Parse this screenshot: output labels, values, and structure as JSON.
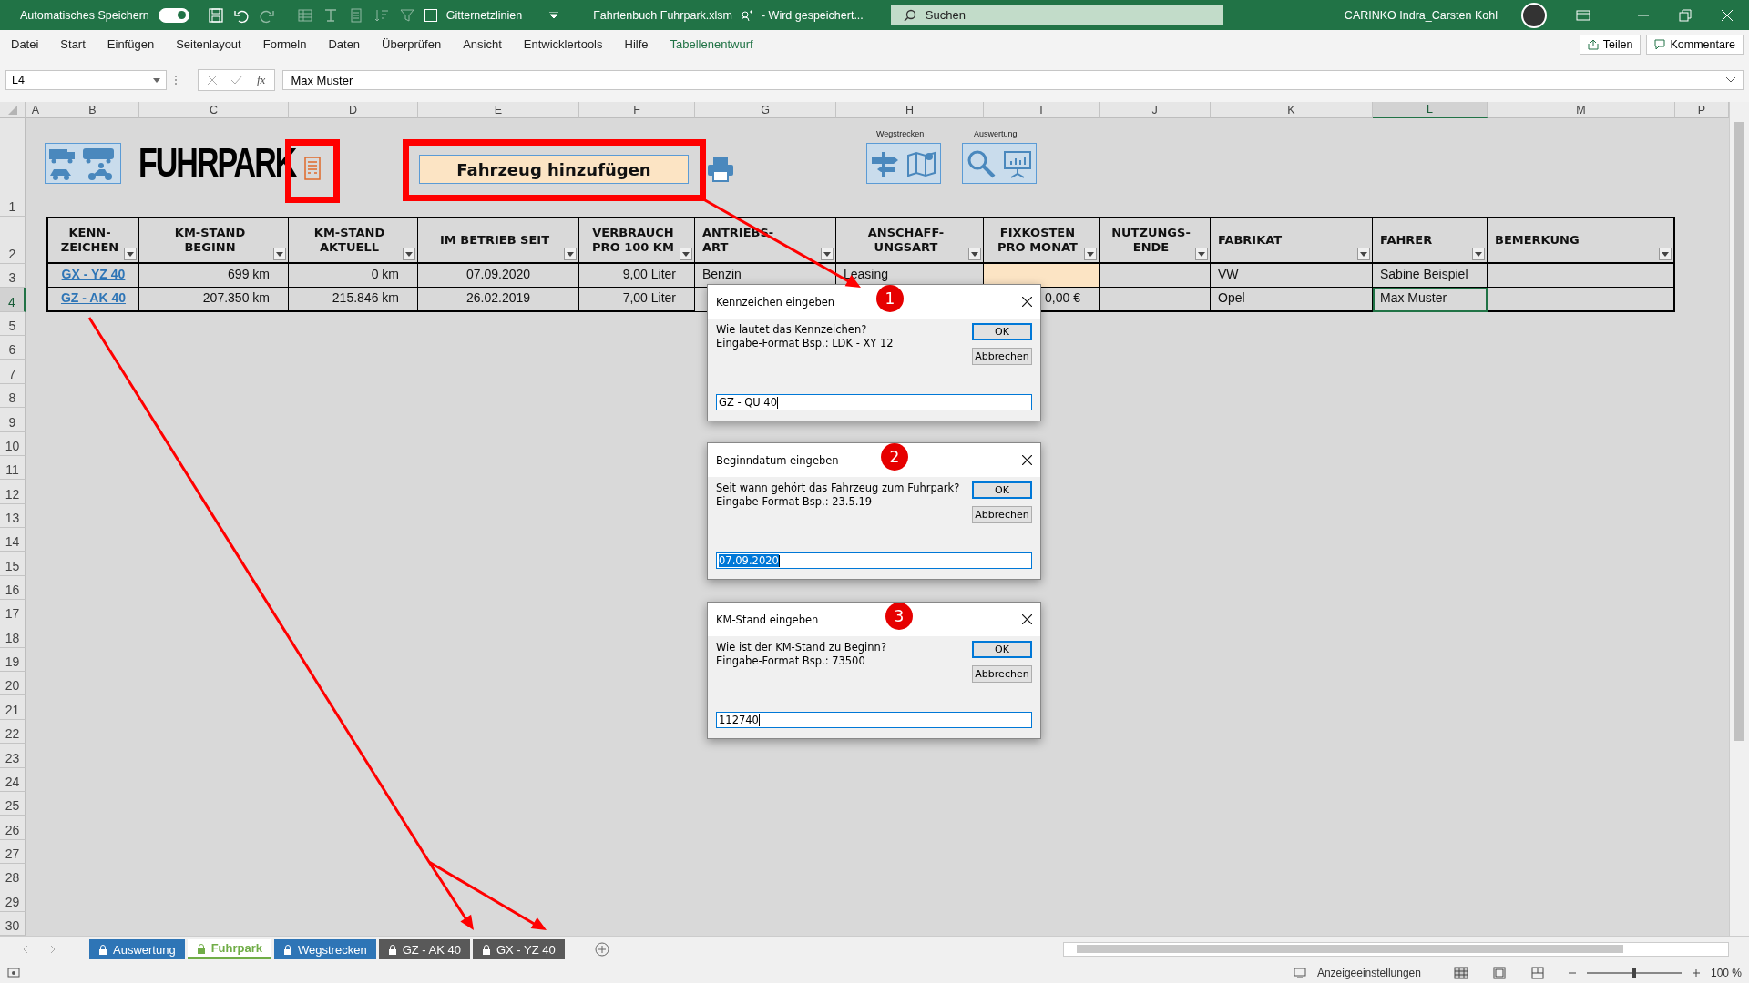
{
  "title_bar": {
    "autosave_label": "Automatisches Speichern",
    "autosave_on": true,
    "gridlines_label": "Gitternetzlinien",
    "gridlines_checked": false,
    "file_name": "Fahrtenbuch Fuhrpark.xlsm",
    "save_status": "- Wird gespeichert...",
    "search_placeholder": "Suchen",
    "user": "CARINKO Indra_Carsten Kohl"
  },
  "menu": [
    {
      "label": "Datei",
      "kind": "tab"
    },
    {
      "label": "Start",
      "kind": "tab"
    },
    {
      "label": "Einfügen",
      "kind": "tab"
    },
    {
      "label": "Seitenlayout",
      "kind": "tab"
    },
    {
      "label": "Formeln",
      "kind": "tab"
    },
    {
      "label": "Daten",
      "kind": "tab"
    },
    {
      "label": "Überprüfen",
      "kind": "tab"
    },
    {
      "label": "Ansicht",
      "kind": "tab"
    },
    {
      "label": "Entwicklertools",
      "kind": "tab"
    },
    {
      "label": "Hilfe",
      "kind": "tab"
    },
    {
      "label": "Tabellenentwurf",
      "kind": "context"
    }
  ],
  "share_button": "Teilen",
  "comments_button": "Kommentare",
  "formula_bar": {
    "name_box": "L4",
    "function_label": "fx",
    "value": "Max Muster"
  },
  "column_headers": [
    {
      "label": "A",
      "selected": false
    },
    {
      "label": "B",
      "selected": false
    },
    {
      "label": "C",
      "selected": false
    },
    {
      "label": "D",
      "selected": false
    },
    {
      "label": "E",
      "selected": false
    },
    {
      "label": "F",
      "selected": false
    },
    {
      "label": "G",
      "selected": false
    },
    {
      "label": "H",
      "selected": false
    },
    {
      "label": "I",
      "selected": false
    },
    {
      "label": "J",
      "selected": false
    },
    {
      "label": "K",
      "selected": false
    },
    {
      "label": "L",
      "selected": true
    },
    {
      "label": "M",
      "selected": false
    },
    {
      "label": "P",
      "selected": false
    }
  ],
  "row_headers": [
    {
      "label": "1",
      "selected": false
    },
    {
      "label": "2",
      "selected": false
    },
    {
      "label": "3",
      "selected": false
    },
    {
      "label": "4",
      "selected": true
    },
    {
      "label": "5",
      "selected": false
    },
    {
      "label": "6",
      "selected": false
    },
    {
      "label": "7",
      "selected": false
    },
    {
      "label": "8",
      "selected": false
    },
    {
      "label": "9",
      "selected": false
    },
    {
      "label": "10",
      "selected": false
    },
    {
      "label": "11",
      "selected": false
    },
    {
      "label": "12",
      "selected": false
    },
    {
      "label": "13",
      "selected": false
    },
    {
      "label": "14",
      "selected": false
    },
    {
      "label": "15",
      "selected": false
    },
    {
      "label": "16",
      "selected": false
    },
    {
      "label": "17",
      "selected": false
    },
    {
      "label": "18",
      "selected": false
    },
    {
      "label": "19",
      "selected": false
    },
    {
      "label": "20",
      "selected": false
    },
    {
      "label": "21",
      "selected": false
    },
    {
      "label": "22",
      "selected": false
    },
    {
      "label": "23",
      "selected": false
    },
    {
      "label": "24",
      "selected": false
    },
    {
      "label": "25",
      "selected": false
    },
    {
      "label": "26",
      "selected": false
    },
    {
      "label": "27",
      "selected": false
    },
    {
      "label": "28",
      "selected": false
    },
    {
      "label": "29",
      "selected": false
    },
    {
      "label": "30",
      "selected": false
    }
  ],
  "sheet_title": "FUHRPARK",
  "add_vehicle_button": "Fahrzeug hinzufügen",
  "shortcut_groups": [
    {
      "label": "Wegstrecken"
    },
    {
      "label": "Auswertung"
    }
  ],
  "table": {
    "columns": [
      "KENN-\nZEICHEN",
      "KM-STAND\nBEGINN",
      "KM-STAND\nAKTUELL",
      "IM BETRIEB SEIT",
      "VERBRAUCH\nPRO 100 KM",
      "ANTRIEBS-\nART",
      "ANSCHAFF-\nUNGSART",
      "FIXKOSTEN\nPRO MONAT",
      "NUTZUNGS-\nENDE",
      "FABRIKAT",
      "FAHRER",
      "BEMERKUNG"
    ],
    "rows": [
      {
        "cells": [
          {
            "text": "GX - YZ 40",
            "selected": false,
            "highlighted": false
          },
          {
            "text": "699 km",
            "selected": false,
            "highlighted": false
          },
          {
            "text": "0 km",
            "selected": false,
            "highlighted": false
          },
          {
            "text": "07.09.2020",
            "selected": false,
            "highlighted": false
          },
          {
            "text": "9,00 Liter",
            "selected": false,
            "highlighted": false
          },
          {
            "text": "Benzin",
            "selected": false,
            "highlighted": false
          },
          {
            "text": "Leasing",
            "selected": false,
            "highlighted": false
          },
          {
            "selected": false,
            "highlighted": true
          },
          {
            "selected": false,
            "highlighted": false
          },
          {
            "text": "VW",
            "selected": false,
            "highlighted": false
          },
          {
            "text": "Sabine Beispiel",
            "selected": false,
            "highlighted": false
          },
          {
            "selected": false,
            "highlighted": false
          }
        ]
      },
      {
        "cells": [
          {
            "text": "GZ - AK 40",
            "selected": false,
            "highlighted": false
          },
          {
            "text": "207.350 km",
            "selected": false,
            "highlighted": false
          },
          {
            "text": "215.846 km",
            "selected": false,
            "highlighted": false
          },
          {
            "text": "26.02.2019",
            "selected": false,
            "highlighted": false
          },
          {
            "text": "7,00 Liter",
            "selected": false,
            "highlighted": false
          },
          null,
          null,
          {
            "text": "0,00 €",
            "selected": false,
            "highlighted": false
          },
          {
            "selected": false,
            "highlighted": false
          },
          {
            "text": "Opel",
            "selected": false,
            "highlighted": false
          },
          {
            "text": "Max Muster",
            "selected": true,
            "highlighted": false
          },
          {
            "selected": false,
            "highlighted": false
          }
        ]
      }
    ]
  },
  "dialogs": [
    {
      "title": "Kennzeichen eingeben",
      "badge": "1",
      "message": [
        "Wie lautet das Kennzeichen?",
        "Eingabe-Format Bsp.: LDK - XY 12"
      ],
      "ok": "OK",
      "cancel": "Abbrechen",
      "value": "GZ - QU 40",
      "value_selected": false
    },
    {
      "title": "Beginndatum eingeben",
      "badge": "2",
      "message": [
        "Seit wann gehört das Fahrzeug zum Fuhrpark?",
        "Eingabe-Format Bsp.: 23.5.19"
      ],
      "ok": "OK",
      "cancel": "Abbrechen",
      "value": "07.09.2020",
      "value_selected": true
    },
    {
      "title": "KM-Stand eingeben",
      "badge": "3",
      "message": [
        "Wie ist der KM-Stand zu Beginn?",
        "Eingabe-Format Bsp.: 73500"
      ],
      "ok": "OK",
      "cancel": "Abbrechen",
      "value": "112740",
      "value_selected": false
    }
  ],
  "sheet_tabs": [
    {
      "label": "Auswertung",
      "selected": false,
      "color": "#2e75b6"
    },
    {
      "label": "Fuhrpark",
      "selected": true,
      "color": "#70ad47"
    },
    {
      "label": "Wegstrecken",
      "selected": false,
      "color": "#2e75b6"
    },
    {
      "label": "GZ - AK 40",
      "selected": false,
      "color": "#595959"
    },
    {
      "label": "GX - YZ 40",
      "selected": false,
      "color": "#595959"
    }
  ],
  "status_bar": {
    "display_settings": "Anzeigeeinstellungen",
    "zoom_slider": {
      "level": 0.5
    },
    "zoom": "100 %"
  }
}
